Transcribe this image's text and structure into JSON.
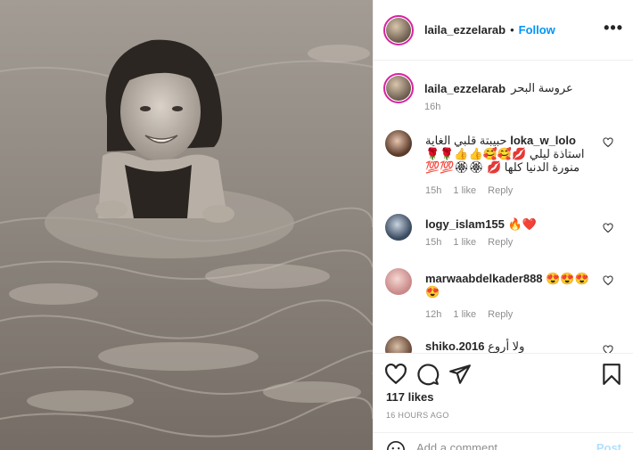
{
  "post": {
    "author": "laila_ezzelarab",
    "follow_label": "Follow",
    "more_label": "•••",
    "caption_text": "عروسة البحر",
    "caption_time": "16h",
    "likes": "117 likes",
    "posted": "16 HOURS AGO",
    "photo_description_icon": "photo-girl-in-sea"
  },
  "comments": [
    {
      "username": "loka_w_lolo",
      "text": "حبيبتة قلبي الغاية استاذة ليلي 💋🥰🥰👍👍🌹🌹 منورة الدنيا كلها 💋 🏵🏵💯💯",
      "time": "15h",
      "likes": "1 like",
      "reply": "Reply"
    },
    {
      "username": "logy_islam155",
      "text": "🔥❤️",
      "time": "15h",
      "likes": "1 like",
      "reply": "Reply"
    },
    {
      "username": "marwaabdelkader888",
      "text": "😍😍😍 😍",
      "time": "12h",
      "likes": "1 like",
      "reply": "Reply"
    },
    {
      "username": "shiko.2016",
      "text": "ولا أروع",
      "time": "",
      "likes": "",
      "reply": ""
    }
  ],
  "composer": {
    "placeholder": "Add a comment...",
    "post_label": "Post"
  },
  "icons": {
    "like": "heart-icon",
    "comment": "comment-icon",
    "share": "share-icon",
    "save": "bookmark-icon",
    "emoji": "emoji-icon"
  },
  "colors": {
    "accent": "#0095f6",
    "post_disabled": "#b2dffc",
    "muted": "#8e8e8e"
  }
}
